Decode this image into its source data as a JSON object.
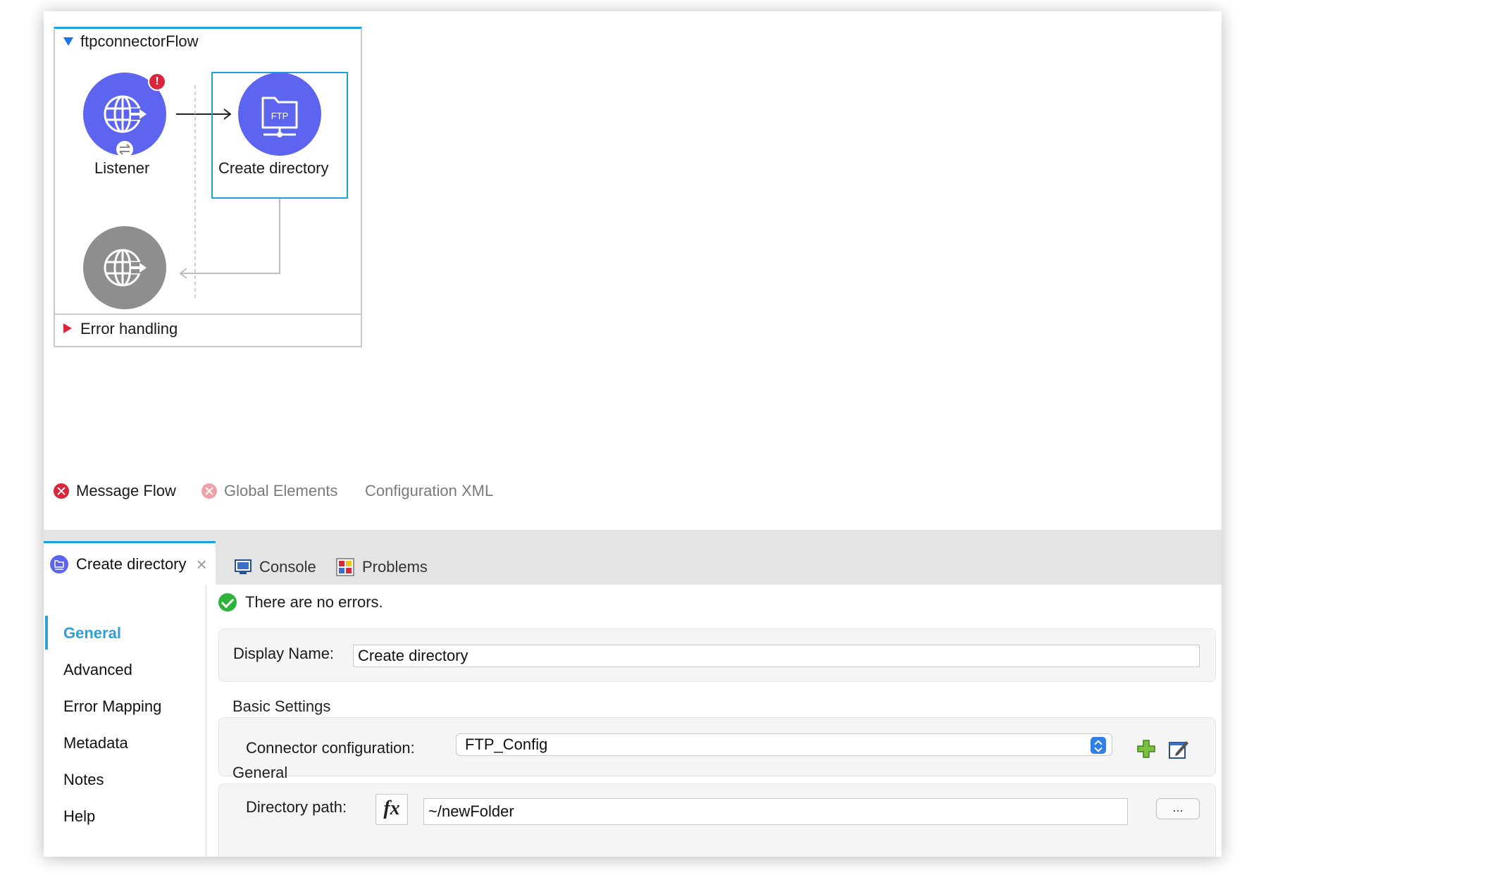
{
  "flow": {
    "title": "ftpconnectorFlow",
    "nodes": {
      "listener": "Listener",
      "create_directory": "Create directory",
      "ftp_badge": "FTP",
      "listener_error_badge": "!"
    },
    "error_handling": "Error handling"
  },
  "editor_tabs": {
    "message_flow": "Message Flow",
    "global_elements": "Global Elements",
    "configuration_xml": "Configuration XML"
  },
  "panel_tabs": {
    "create_directory": "Create directory",
    "console": "Console",
    "problems": "Problems",
    "close_glyph": "×"
  },
  "sidebar": {
    "items": [
      {
        "label": "General",
        "active": true
      },
      {
        "label": "Advanced"
      },
      {
        "label": "Error Mapping"
      },
      {
        "label": "Metadata"
      },
      {
        "label": "Notes"
      },
      {
        "label": "Help"
      }
    ]
  },
  "status": "There are no errors.",
  "form": {
    "display_name_label": "Display Name:",
    "display_name_value": "Create directory",
    "basic_settings": "Basic Settings",
    "connector_config_label": "Connector configuration:",
    "connector_config_value": "FTP_Config",
    "general_section": "General",
    "directory_path_label": "Directory path:",
    "fx": "fx",
    "directory_path_value": "~/newFolder",
    "browse": "..."
  },
  "colors": {
    "accent": "#1ba1e2",
    "node_purple": "#5c64f0",
    "node_grey": "#8e8e8e",
    "error_red": "#d8263b",
    "ok_green": "#2cb33a"
  }
}
